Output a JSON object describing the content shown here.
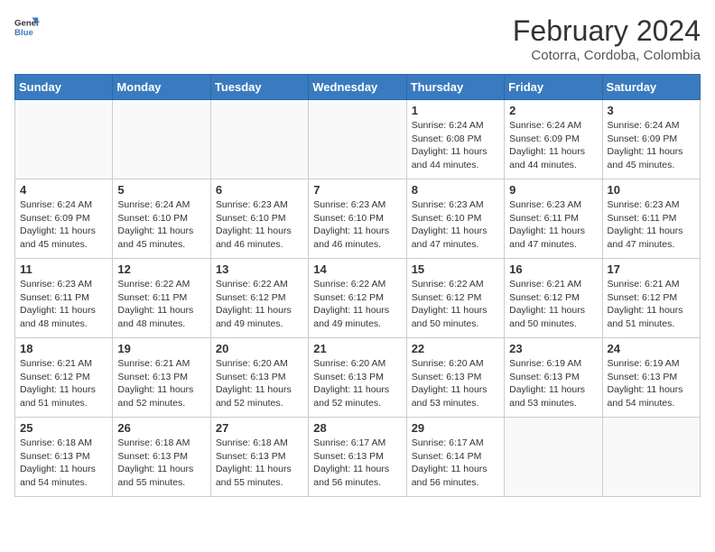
{
  "logo": {
    "line1": "General",
    "line2": "Blue"
  },
  "title": "February 2024",
  "subtitle": "Cotorra, Cordoba, Colombia",
  "days_of_week": [
    "Sunday",
    "Monday",
    "Tuesday",
    "Wednesday",
    "Thursday",
    "Friday",
    "Saturday"
  ],
  "weeks": [
    [
      {
        "day": "",
        "info": ""
      },
      {
        "day": "",
        "info": ""
      },
      {
        "day": "",
        "info": ""
      },
      {
        "day": "",
        "info": ""
      },
      {
        "day": "1",
        "info": "Sunrise: 6:24 AM\nSunset: 6:08 PM\nDaylight: 11 hours and 44 minutes."
      },
      {
        "day": "2",
        "info": "Sunrise: 6:24 AM\nSunset: 6:09 PM\nDaylight: 11 hours and 44 minutes."
      },
      {
        "day": "3",
        "info": "Sunrise: 6:24 AM\nSunset: 6:09 PM\nDaylight: 11 hours and 45 minutes."
      }
    ],
    [
      {
        "day": "4",
        "info": "Sunrise: 6:24 AM\nSunset: 6:09 PM\nDaylight: 11 hours and 45 minutes."
      },
      {
        "day": "5",
        "info": "Sunrise: 6:24 AM\nSunset: 6:10 PM\nDaylight: 11 hours and 45 minutes."
      },
      {
        "day": "6",
        "info": "Sunrise: 6:23 AM\nSunset: 6:10 PM\nDaylight: 11 hours and 46 minutes."
      },
      {
        "day": "7",
        "info": "Sunrise: 6:23 AM\nSunset: 6:10 PM\nDaylight: 11 hours and 46 minutes."
      },
      {
        "day": "8",
        "info": "Sunrise: 6:23 AM\nSunset: 6:10 PM\nDaylight: 11 hours and 47 minutes."
      },
      {
        "day": "9",
        "info": "Sunrise: 6:23 AM\nSunset: 6:11 PM\nDaylight: 11 hours and 47 minutes."
      },
      {
        "day": "10",
        "info": "Sunrise: 6:23 AM\nSunset: 6:11 PM\nDaylight: 11 hours and 47 minutes."
      }
    ],
    [
      {
        "day": "11",
        "info": "Sunrise: 6:23 AM\nSunset: 6:11 PM\nDaylight: 11 hours and 48 minutes."
      },
      {
        "day": "12",
        "info": "Sunrise: 6:22 AM\nSunset: 6:11 PM\nDaylight: 11 hours and 48 minutes."
      },
      {
        "day": "13",
        "info": "Sunrise: 6:22 AM\nSunset: 6:12 PM\nDaylight: 11 hours and 49 minutes."
      },
      {
        "day": "14",
        "info": "Sunrise: 6:22 AM\nSunset: 6:12 PM\nDaylight: 11 hours and 49 minutes."
      },
      {
        "day": "15",
        "info": "Sunrise: 6:22 AM\nSunset: 6:12 PM\nDaylight: 11 hours and 50 minutes."
      },
      {
        "day": "16",
        "info": "Sunrise: 6:21 AM\nSunset: 6:12 PM\nDaylight: 11 hours and 50 minutes."
      },
      {
        "day": "17",
        "info": "Sunrise: 6:21 AM\nSunset: 6:12 PM\nDaylight: 11 hours and 51 minutes."
      }
    ],
    [
      {
        "day": "18",
        "info": "Sunrise: 6:21 AM\nSunset: 6:12 PM\nDaylight: 11 hours and 51 minutes."
      },
      {
        "day": "19",
        "info": "Sunrise: 6:21 AM\nSunset: 6:13 PM\nDaylight: 11 hours and 52 minutes."
      },
      {
        "day": "20",
        "info": "Sunrise: 6:20 AM\nSunset: 6:13 PM\nDaylight: 11 hours and 52 minutes."
      },
      {
        "day": "21",
        "info": "Sunrise: 6:20 AM\nSunset: 6:13 PM\nDaylight: 11 hours and 52 minutes."
      },
      {
        "day": "22",
        "info": "Sunrise: 6:20 AM\nSunset: 6:13 PM\nDaylight: 11 hours and 53 minutes."
      },
      {
        "day": "23",
        "info": "Sunrise: 6:19 AM\nSunset: 6:13 PM\nDaylight: 11 hours and 53 minutes."
      },
      {
        "day": "24",
        "info": "Sunrise: 6:19 AM\nSunset: 6:13 PM\nDaylight: 11 hours and 54 minutes."
      }
    ],
    [
      {
        "day": "25",
        "info": "Sunrise: 6:18 AM\nSunset: 6:13 PM\nDaylight: 11 hours and 54 minutes."
      },
      {
        "day": "26",
        "info": "Sunrise: 6:18 AM\nSunset: 6:13 PM\nDaylight: 11 hours and 55 minutes."
      },
      {
        "day": "27",
        "info": "Sunrise: 6:18 AM\nSunset: 6:13 PM\nDaylight: 11 hours and 55 minutes."
      },
      {
        "day": "28",
        "info": "Sunrise: 6:17 AM\nSunset: 6:13 PM\nDaylight: 11 hours and 56 minutes."
      },
      {
        "day": "29",
        "info": "Sunrise: 6:17 AM\nSunset: 6:14 PM\nDaylight: 11 hours and 56 minutes."
      },
      {
        "day": "",
        "info": ""
      },
      {
        "day": "",
        "info": ""
      }
    ]
  ]
}
